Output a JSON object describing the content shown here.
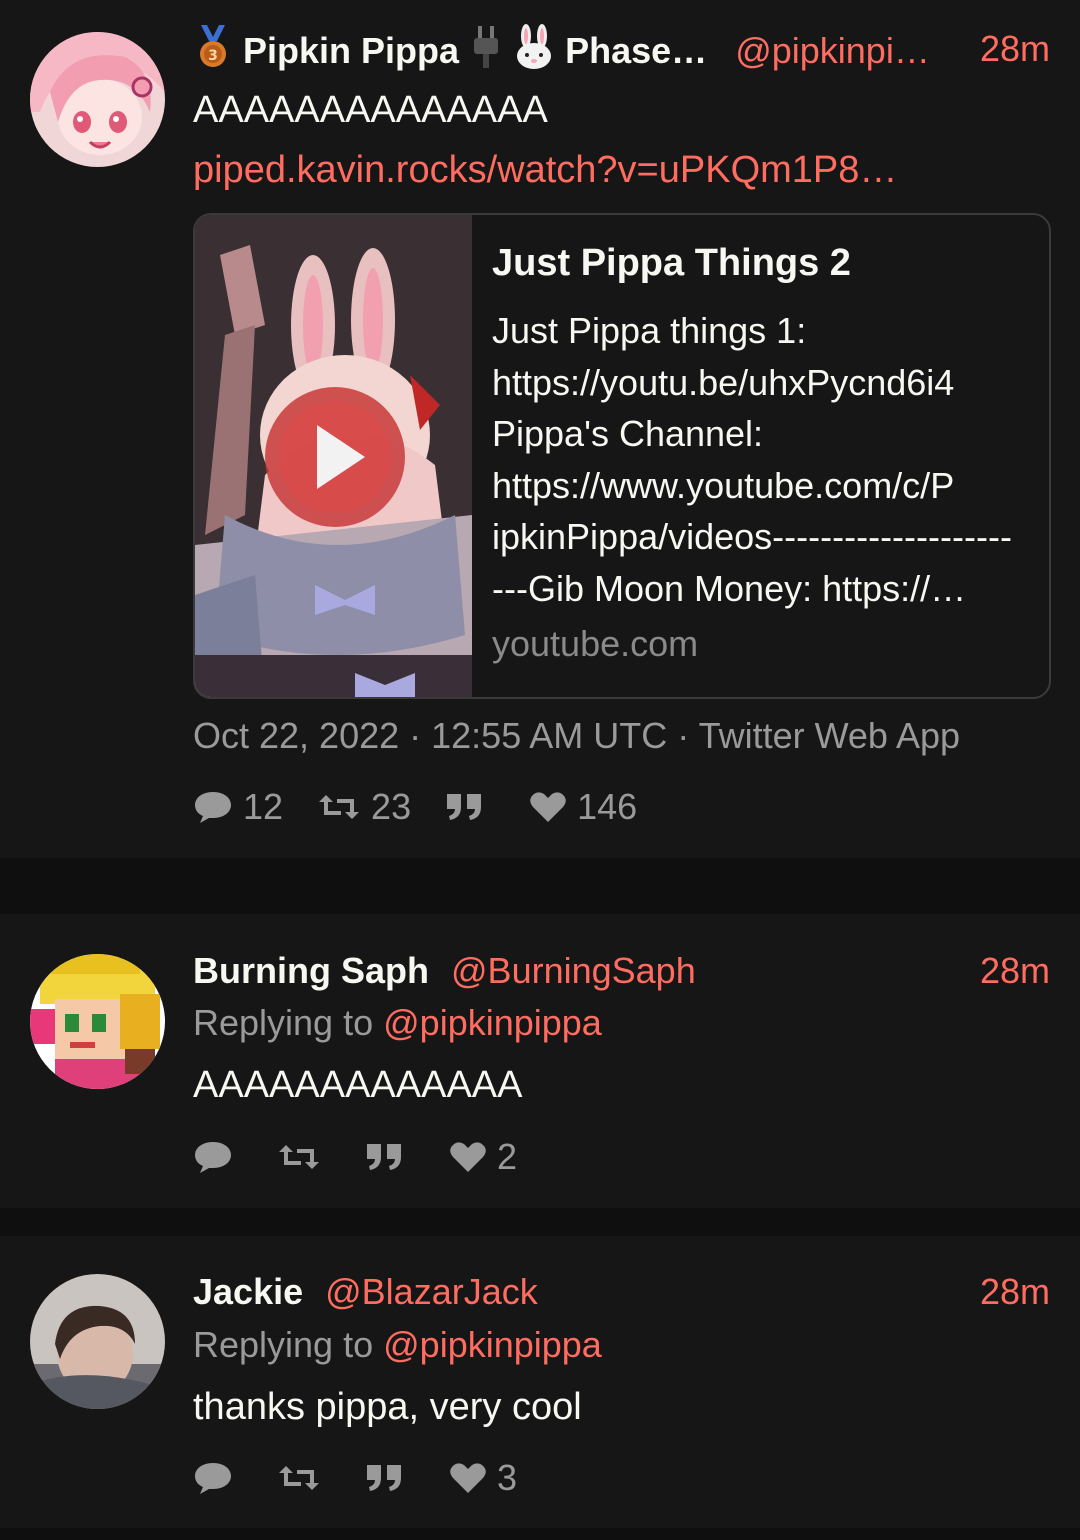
{
  "tweets": [
    {
      "display_name": "Pipkin Pippa",
      "display_name_extra": "Phase…",
      "handle": "@pipkinpi…",
      "time": "28m",
      "text": "AAAAAAAAAAAAAA",
      "link": "piped.kavin.rocks/watch?v=uPKQm1P8…",
      "card": {
        "title": "Just Pippa Things 2",
        "description_lines": [
          "Just Pippa things 1:",
          "https://youtu.be/uhxPycnd6i4",
          "Pippa's Channel:",
          "https://www.youtube.com/c/P",
          "ipkinPippa/videos--------------------",
          "---Gib Moon Money: https://…"
        ],
        "domain": "youtube.com"
      },
      "date": "Oct 22, 2022 · 12:55 AM UTC · Twitter Web App",
      "stats": {
        "replies": "12",
        "retweets": "23",
        "quotes": "",
        "likes": "146"
      }
    },
    {
      "display_name": "Burning Saph",
      "handle": "@BurningSaph",
      "time": "28m",
      "replying_label": "Replying to",
      "replying_to": "@pipkinpippa",
      "text": "AAAAAAAAAAAAA",
      "stats": {
        "replies": "",
        "retweets": "",
        "quotes": "",
        "likes": "2"
      }
    },
    {
      "display_name": "Jackie",
      "handle": "@BlazarJack",
      "time": "28m",
      "replying_label": "Replying to",
      "replying_to": "@pipkinpippa",
      "text": "thanks pippa, very cool",
      "stats": {
        "replies": "",
        "retweets": "",
        "quotes": "",
        "likes": "3"
      }
    }
  ],
  "icons": [
    "medal-icon",
    "plug-icon",
    "rabbit-icon",
    "play-icon",
    "comment-icon",
    "retweet-icon",
    "quote-icon",
    "heart-icon"
  ],
  "colors": {
    "background": "#161616",
    "accent": "#ff6c60",
    "muted": "#9a9a9a"
  }
}
